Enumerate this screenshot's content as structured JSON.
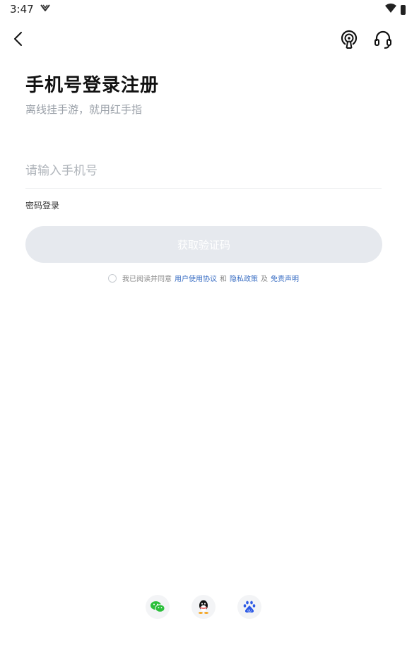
{
  "status_bar": {
    "time": "3:47",
    "carrier_icon": "v-logo"
  },
  "header": {
    "back_icon": "chevron-left",
    "podcast_icon": "podcast-icon",
    "support_icon": "headset-icon"
  },
  "page": {
    "title": "手机号登录注册",
    "subtitle": "离线挂手游，就用红手指"
  },
  "form": {
    "phone_placeholder": "请输入手机号",
    "password_login_label": "密码登录",
    "get_code_label": "获取验证码"
  },
  "agreement": {
    "prefix": "我已阅读并同意",
    "link_user": "用户使用协议",
    "and": "和",
    "link_privacy": "隐私政策",
    "and2": "及",
    "link_disclaimer": "免责声明"
  },
  "social": {
    "items": [
      "wechat-icon",
      "qq-icon",
      "baidu-icon"
    ]
  },
  "colors": {
    "button_disabled": "#e6e9ee",
    "link": "#3b6fc4",
    "wechat": "#2bbf3a",
    "baidu": "#2e5be6"
  }
}
